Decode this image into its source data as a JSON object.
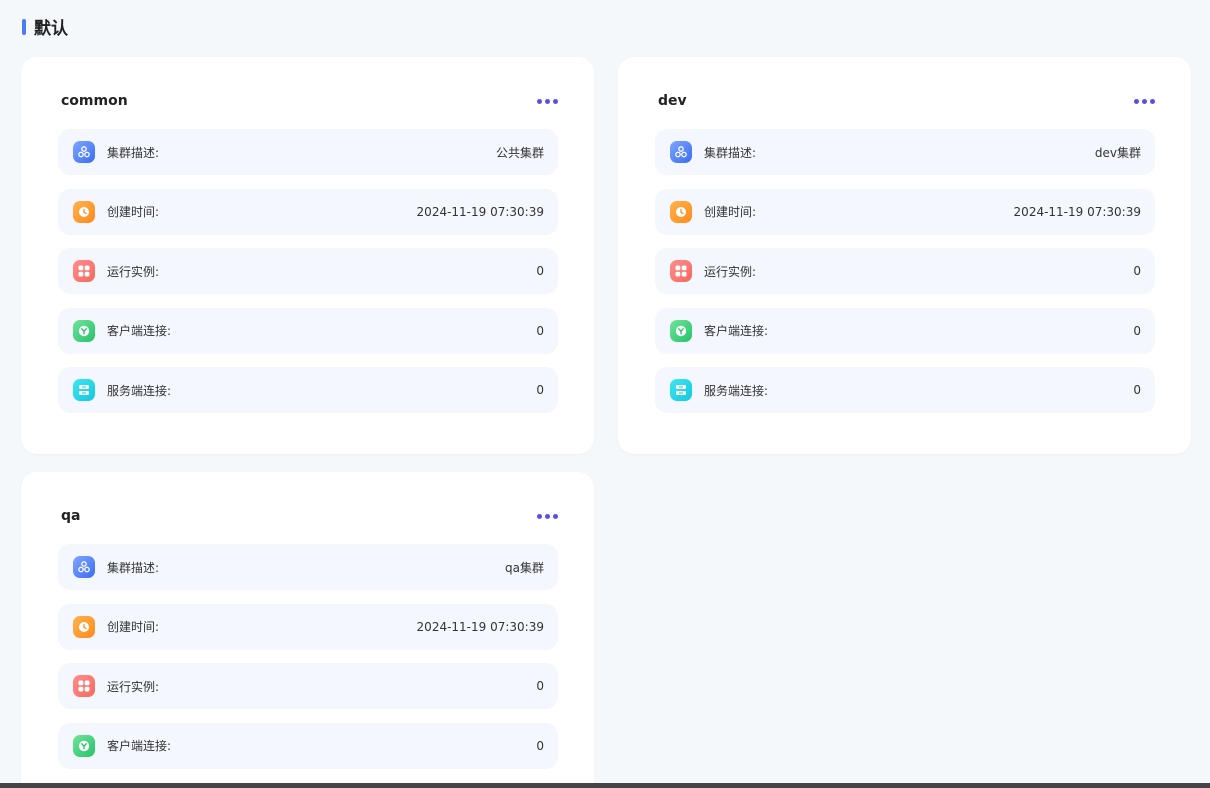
{
  "section": {
    "title": "默认"
  },
  "clusters": [
    {
      "name": "common",
      "rows": [
        {
          "label": "集群描述:",
          "value": "公共集群"
        },
        {
          "label": "创建时间:",
          "value": "2024-11-19 07:30:39"
        },
        {
          "label": "运行实例:",
          "value": "0"
        },
        {
          "label": "客户端连接:",
          "value": "0"
        },
        {
          "label": "服务端连接:",
          "value": "0"
        }
      ]
    },
    {
      "name": "dev",
      "rows": [
        {
          "label": "集群描述:",
          "value": "dev集群"
        },
        {
          "label": "创建时间:",
          "value": "2024-11-19 07:30:39"
        },
        {
          "label": "运行实例:",
          "value": "0"
        },
        {
          "label": "客户端连接:",
          "value": "0"
        },
        {
          "label": "服务端连接:",
          "value": "0"
        }
      ]
    },
    {
      "name": "qa",
      "rows": [
        {
          "label": "集群描述:",
          "value": "qa集群"
        },
        {
          "label": "创建时间:",
          "value": "2024-11-19 07:30:39"
        },
        {
          "label": "运行实例:",
          "value": "0"
        },
        {
          "label": "客户端连接:",
          "value": "0"
        }
      ]
    }
  ],
  "icons": {
    "description": "cluster-icon",
    "created": "clock-icon",
    "instances": "grid-icon",
    "client": "client-connection-icon",
    "server": "server-connection-icon"
  },
  "colors": {
    "accent": "#4b7bf5",
    "more": "#5a4fe0",
    "row_bg": "#f4f7fd",
    "page_bg": "#f5f8fb"
  }
}
